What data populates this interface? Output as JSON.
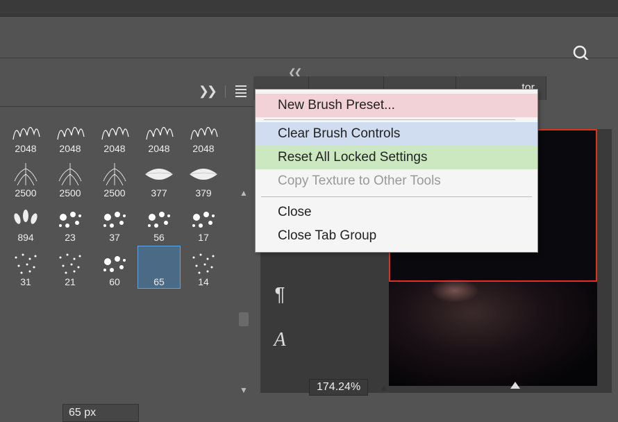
{
  "search": {
    "aria": "Search"
  },
  "brush_panel": {
    "expand_aria": "Expand",
    "menu_aria": "Panel menu",
    "rows": [
      [
        {
          "label": "2048"
        },
        {
          "label": "2048"
        },
        {
          "label": "2048"
        },
        {
          "label": "2048"
        },
        {
          "label": "2048"
        }
      ],
      [
        {
          "label": "2500"
        },
        {
          "label": "2500"
        },
        {
          "label": "2500"
        },
        {
          "label": "377"
        },
        {
          "label": "379"
        }
      ],
      [
        {
          "label": "894"
        },
        {
          "label": "23"
        },
        {
          "label": "37"
        },
        {
          "label": "56"
        },
        {
          "label": "17"
        }
      ],
      [
        {
          "label": "31"
        },
        {
          "label": "21"
        },
        {
          "label": "60"
        },
        {
          "label": "65",
          "selected": true
        },
        {
          "label": "14"
        }
      ]
    ],
    "size_value": "65 px",
    "scroll": {
      "up_aria": "Scroll up",
      "down_aria": "Scroll down"
    }
  },
  "tabs": {
    "collapse_aria": "Collapse panels",
    "items": [
      {
        "label": ""
      },
      {
        "label_suffix": "tor"
      }
    ]
  },
  "side_icons": {
    "paragraph": "¶",
    "type": "A"
  },
  "canvas": {
    "zoom": "174.24%",
    "slider_aria": "Zoom slider"
  },
  "context_menu": {
    "items": [
      {
        "label": "New Brush Preset...",
        "hi": "pink"
      },
      {
        "sep": true,
        "short": true
      },
      {
        "label": "Clear Brush Controls",
        "hi": "blue"
      },
      {
        "label": "Reset All Locked Settings",
        "hi": "green"
      },
      {
        "label": "Copy Texture to Other Tools",
        "disabled": true
      },
      {
        "sep": true
      },
      {
        "label": "Close"
      },
      {
        "label": "Close Tab Group"
      }
    ]
  }
}
